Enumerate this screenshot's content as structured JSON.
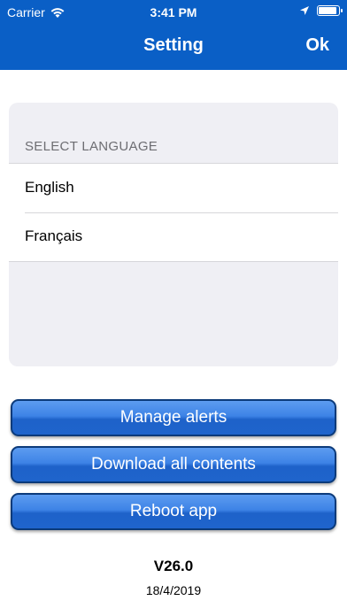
{
  "status_bar": {
    "carrier": "Carrier",
    "time": "3:41 PM"
  },
  "nav": {
    "title": "Setting",
    "ok_label": "Ok"
  },
  "language_section": {
    "header": "SELECT LANGUAGE",
    "options": [
      "English",
      "Français"
    ]
  },
  "buttons": {
    "manage_alerts": "Manage alerts",
    "download_all": "Download all contents",
    "reboot": "Reboot app"
  },
  "footer": {
    "version": "V26.0",
    "date": "18/4/2019"
  },
  "colors": {
    "nav_background": "#0a5fc6",
    "button_blue": "#1e62c9",
    "card_background": "#efeff4"
  }
}
